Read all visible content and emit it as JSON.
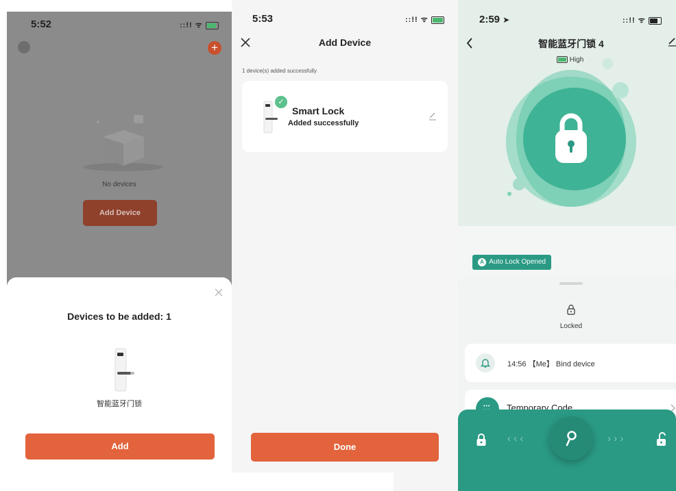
{
  "panel1": {
    "status_time": "5:52",
    "status_icons": "::!! ᯤ",
    "empty_text": "No devices",
    "add_device_label": "Add Device",
    "sheet_title": "Devices to be added: 1",
    "device_name": "智能蓝牙门锁",
    "add_label": "Add"
  },
  "panel2": {
    "status_time": "5:53",
    "status_icons": "::!! ᯤ",
    "title": "Add Device",
    "subtitle": "1 device(s) added successfully",
    "device_name": "Smart Lock",
    "device_status": "Added successfully",
    "done_label": "Done"
  },
  "panel3": {
    "status_time": "2:59",
    "status_icons": "::!! ᯤ",
    "title": "智能蓝牙门锁 4",
    "battery_label": "High",
    "auto_lock_badge": "Auto Lock Opened",
    "auto_lock_glyph": "A",
    "lock_state": "Locked",
    "event_text": "14:56 【Me】 Bind device",
    "temp_code_label": "Temporary Code",
    "left_arrows": "‹ ‹ ‹",
    "right_arrows": "› › ›"
  },
  "colors": {
    "orange": "#e2633c",
    "teal": "#2a9a84",
    "green_check": "#5cc18d"
  },
  "icons": [
    "back-icon",
    "close-icon",
    "edit-icon",
    "plus-icon",
    "padlock-icon",
    "bell-icon",
    "keypad-icon",
    "key-icon",
    "chevron-right-icon",
    "battery-icon",
    "wifi-icon",
    "signal-icon"
  ]
}
